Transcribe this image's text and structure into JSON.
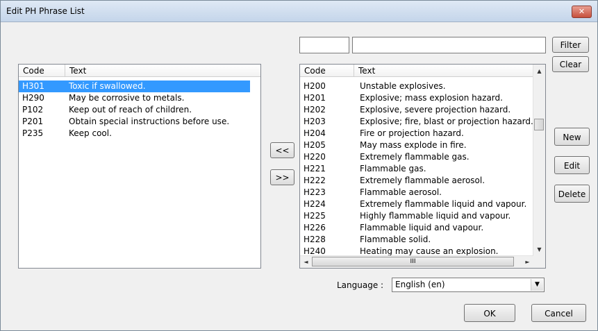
{
  "window": {
    "title": "Edit PH Phrase List",
    "close_glyph": "✕"
  },
  "buttons": {
    "filter": "Filter",
    "clear": "Clear",
    "new": "New",
    "edit": "Edit",
    "delete": "Delete",
    "move_left": "<<",
    "move_right": ">>",
    "ok": "OK",
    "cancel": "Cancel"
  },
  "filter": {
    "code_value": "",
    "text_value": ""
  },
  "left_list": {
    "headers": {
      "code": "Code",
      "text": "Text"
    },
    "rows": [
      {
        "code": "H301",
        "text": "Toxic if swallowed.",
        "selected": true
      },
      {
        "code": "H290",
        "text": "May be corrosive to metals."
      },
      {
        "code": "P102",
        "text": "Keep out of reach of children."
      },
      {
        "code": "P201",
        "text": "Obtain special instructions before use."
      },
      {
        "code": "P235",
        "text": "Keep cool."
      }
    ]
  },
  "right_list": {
    "headers": {
      "code": "Code",
      "text": "Text"
    },
    "rows": [
      {
        "code": "H200",
        "text": "Unstable explosives."
      },
      {
        "code": "H201",
        "text": "Explosive; mass explosion hazard."
      },
      {
        "code": "H202",
        "text": "Explosive, severe projection hazard."
      },
      {
        "code": "H203",
        "text": "Explosive; fire, blast or projection hazard."
      },
      {
        "code": "H204",
        "text": "Fire or projection hazard."
      },
      {
        "code": "H205",
        "text": "May mass explode in fire."
      },
      {
        "code": "H220",
        "text": "Extremely flammable gas."
      },
      {
        "code": "H221",
        "text": "Flammable gas."
      },
      {
        "code": "H222",
        "text": "Extremely flammable aerosol."
      },
      {
        "code": "H223",
        "text": "Flammable aerosol."
      },
      {
        "code": "H224",
        "text": "Extremely flammable liquid and vapour."
      },
      {
        "code": "H225",
        "text": "Highly flammable liquid and vapour."
      },
      {
        "code": "H226",
        "text": "Flammable liquid and vapour."
      },
      {
        "code": "H228",
        "text": "Flammable solid."
      },
      {
        "code": "H240",
        "text": "Heating may cause an explosion."
      }
    ],
    "hscroll_glyph": "III",
    "arrows": {
      "up": "▲",
      "down": "▼",
      "left": "◄",
      "right": "►"
    }
  },
  "language": {
    "label": "Language :",
    "value": "English (en)",
    "arrow": "▼"
  }
}
